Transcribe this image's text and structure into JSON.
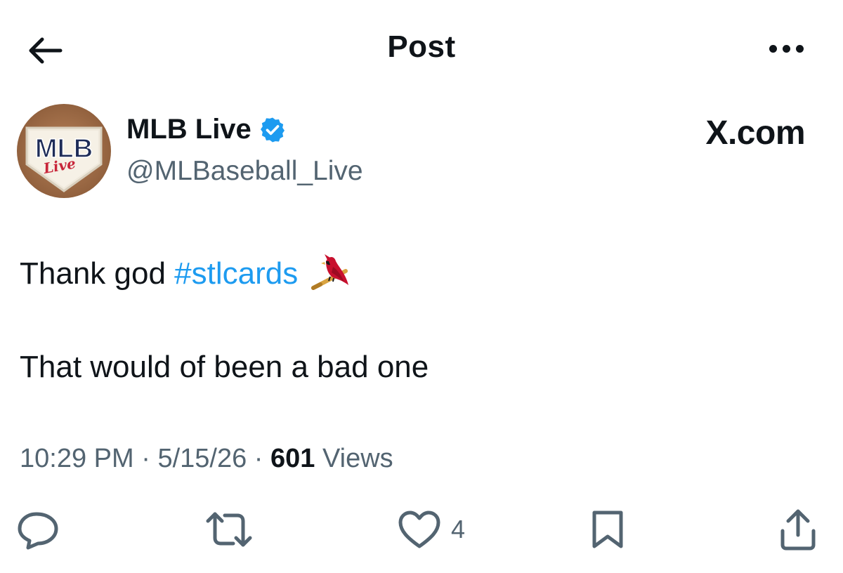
{
  "header": {
    "title": "Post"
  },
  "author": {
    "name": "MLB Live",
    "handle": "@MLBaseball_Live",
    "verified": true,
    "avatar_text": "MLB",
    "avatar_script": "Live"
  },
  "source": {
    "label": "X.com"
  },
  "tweet": {
    "line1_text": "Thank god",
    "hashtag": "#stlcards",
    "emoji": "cardinal-on-bat-icon",
    "line2_text": "That would of been a bad one"
  },
  "meta": {
    "time": "10:29 PM",
    "separator": "·",
    "date": "5/15/26",
    "views_count": "601",
    "views_label": "Views"
  },
  "actions": {
    "likes_count": "4"
  },
  "colors": {
    "text": "#0f1419",
    "secondary": "#536471",
    "link": "#1d9bf0",
    "verified": "#1d9bf0"
  }
}
